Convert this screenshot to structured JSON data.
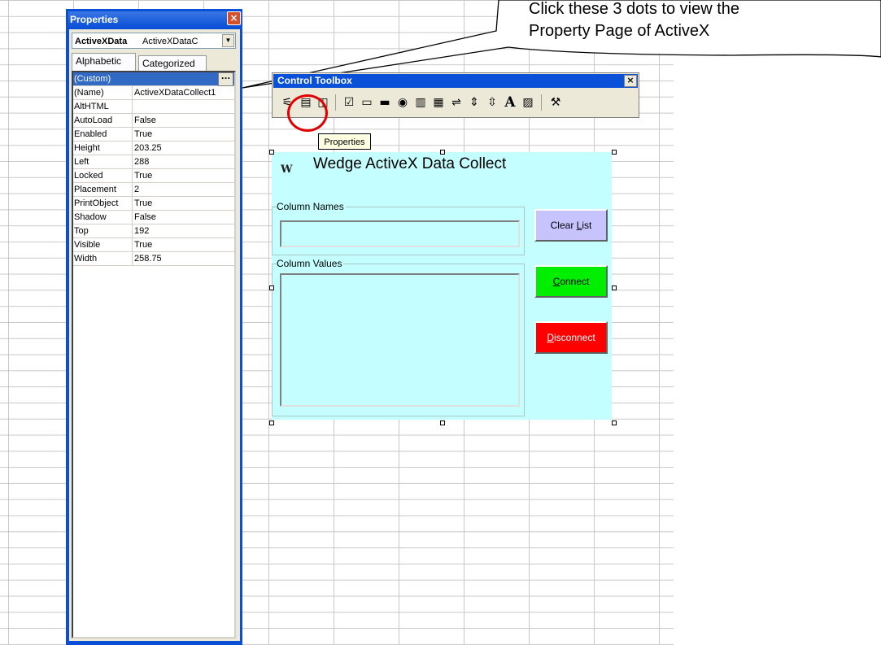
{
  "callout": {
    "line1": "Click these 3 dots to view the",
    "line2": "Property Page of ActiveX"
  },
  "properties": {
    "title": "Properties",
    "object_name": "ActiveXData",
    "object_type": "ActiveXDataC",
    "tabs": [
      "Alphabetic",
      "Categorized"
    ],
    "dots_label": "...",
    "rows": [
      {
        "name": "(Custom)",
        "value": ""
      },
      {
        "name": "(Name)",
        "value": "ActiveXDataCollect1"
      },
      {
        "name": "AltHTML",
        "value": ""
      },
      {
        "name": "AutoLoad",
        "value": "False"
      },
      {
        "name": "Enabled",
        "value": "True"
      },
      {
        "name": "Height",
        "value": "203.25"
      },
      {
        "name": "Left",
        "value": "288"
      },
      {
        "name": "Locked",
        "value": "True"
      },
      {
        "name": "Placement",
        "value": "2"
      },
      {
        "name": "PrintObject",
        "value": "True"
      },
      {
        "name": "Shadow",
        "value": "False"
      },
      {
        "name": "Top",
        "value": "192"
      },
      {
        "name": "Visible",
        "value": "True"
      },
      {
        "name": "Width",
        "value": "258.75"
      }
    ]
  },
  "toolbox": {
    "title": "Control Toolbox",
    "close": "×",
    "tooltip": "Properties",
    "tools": [
      {
        "name": "design-mode-icon",
        "glyph": "⚟"
      },
      {
        "name": "properties-icon",
        "glyph": "▤"
      },
      {
        "name": "view-code-icon",
        "glyph": "◫"
      },
      {
        "name": "checkbox-icon",
        "glyph": "☑"
      },
      {
        "name": "textbox-icon",
        "glyph": "▭"
      },
      {
        "name": "command-button-icon",
        "glyph": "▬"
      },
      {
        "name": "option-button-icon",
        "glyph": "◉"
      },
      {
        "name": "listbox-icon",
        "glyph": "▥"
      },
      {
        "name": "combobox-icon",
        "glyph": "▦"
      },
      {
        "name": "toggle-button-icon",
        "glyph": "⇌"
      },
      {
        "name": "spin-button-icon",
        "glyph": "⇕"
      },
      {
        "name": "scrollbar-icon",
        "glyph": "⇳"
      },
      {
        "name": "label-icon",
        "glyph": "A"
      },
      {
        "name": "image-icon",
        "glyph": "▨"
      },
      {
        "name": "more-controls-icon",
        "glyph": "⚒"
      }
    ]
  },
  "activex": {
    "logo": "W",
    "title": "Wedge ActiveX Data Collect",
    "column_names_label": "Column Names",
    "column_values_label": "Column Values",
    "clear_prefix": "Clear ",
    "clear_key": "L",
    "clear_rest": "ist",
    "connect_key": "C",
    "connect_rest": "onnect",
    "disconnect_key": "D",
    "disconnect_rest": "isconnect",
    "colors": {
      "background": "#c4feff",
      "clear": "#c7c3ff",
      "connect": "#00ee00",
      "disconnect": "#ff0000"
    }
  }
}
